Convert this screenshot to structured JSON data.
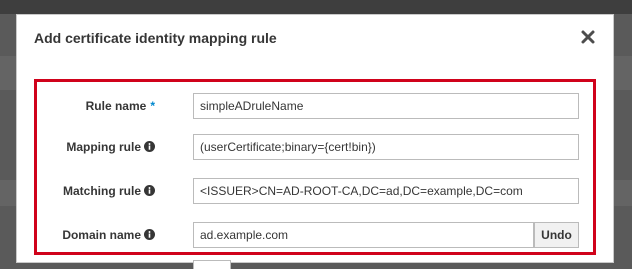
{
  "dialog": {
    "title": "Add certificate identity mapping rule"
  },
  "form": {
    "rule_name": {
      "label": "Rule name",
      "required_marker": "*",
      "value": "simpleADruleName"
    },
    "mapping_rule": {
      "label": "Mapping rule",
      "value": "(userCertificate;binary={cert!bin})"
    },
    "matching_rule": {
      "label": "Matching rule",
      "value": "<ISSUER>CN=AD-ROOT-CA,DC=ad,DC=example,DC=com"
    },
    "domain_name": {
      "label": "Domain name",
      "value": "ad.example.com",
      "undo_label": "Undo"
    }
  },
  "icons": {
    "close": "close-icon",
    "info": "info-icon"
  },
  "colors": {
    "highlight": "#d0021b",
    "required": "#0088ce",
    "overlay": "#5a5a5a"
  }
}
